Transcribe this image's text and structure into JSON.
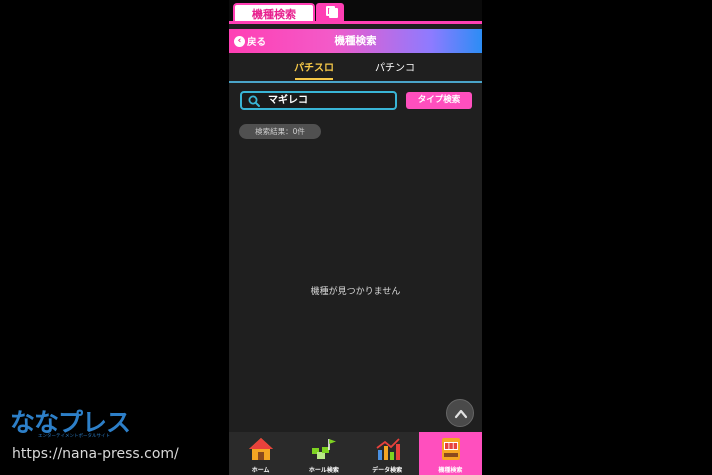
{
  "top_tab": {
    "label": "機種検索",
    "icon": "windows-icon"
  },
  "header": {
    "back_label": "戻る",
    "title": "機種検索"
  },
  "segments": [
    {
      "label": "パチスロ",
      "active": true
    },
    {
      "label": "パチンコ",
      "active": false
    }
  ],
  "search": {
    "value": "マギレコ",
    "button_label": "タイプ検索"
  },
  "results": {
    "count_label": "検索結果：0件",
    "empty_message": "機種が見つかりません"
  },
  "nav": [
    {
      "label": "ホーム",
      "icon": "house-icon",
      "active": false
    },
    {
      "label": "ホール検索",
      "icon": "map-flag-icon",
      "active": false
    },
    {
      "label": "データ検索",
      "icon": "bar-chart-icon",
      "active": false
    },
    {
      "label": "機種検索",
      "icon": "slot-machine-icon",
      "active": true
    }
  ],
  "watermark": {
    "logo": "ななプレス",
    "tagline": "エンターテイメントポータルサイト",
    "url": "https://nana-press.com/"
  },
  "colors": {
    "accent_pink": "#ff4fbe",
    "active_tab": "#f7c948",
    "search_border": "#39b5d6"
  }
}
